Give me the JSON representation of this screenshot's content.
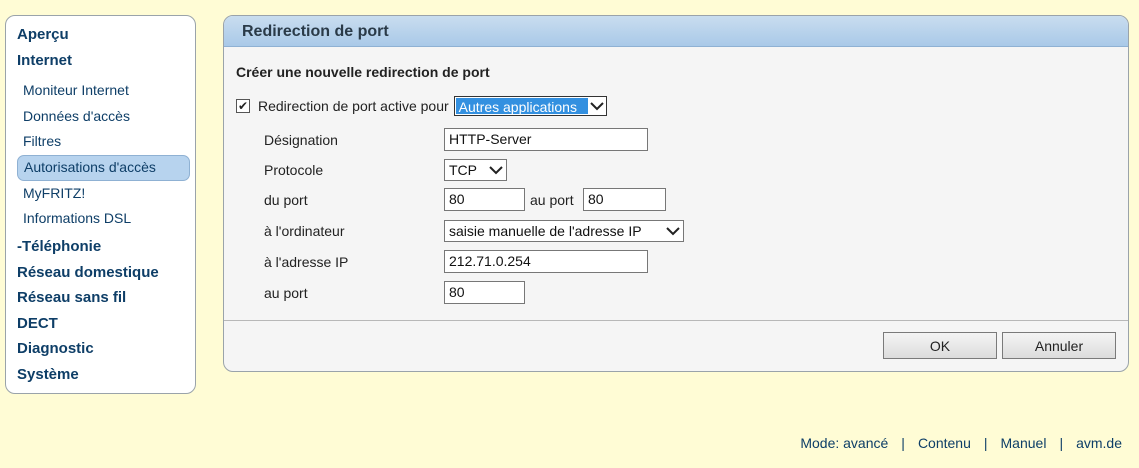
{
  "sidebar": {
    "items": [
      {
        "label": "Aperçu"
      },
      {
        "label": "Internet"
      },
      {
        "label": "Moniteur Internet"
      },
      {
        "label": "Données d'accès"
      },
      {
        "label": "Filtres"
      },
      {
        "label": "Autorisations d'accès"
      },
      {
        "label": "MyFRITZ!"
      },
      {
        "label": "Informations DSL"
      },
      {
        "label": "-Téléphonie"
      },
      {
        "label": "Réseau domestique"
      },
      {
        "label": "Réseau sans fil"
      },
      {
        "label": "DECT"
      },
      {
        "label": "Diagnostic"
      },
      {
        "label": "Système"
      }
    ]
  },
  "panel": {
    "title": "Redirection de port",
    "form_title": "Créer une nouvelle redirection de port",
    "active_checkbox": {
      "checked": true,
      "label": "Redirection de port active pour"
    },
    "application_select": {
      "value": "Autres applications"
    },
    "designation": {
      "label": "Désignation",
      "value": "HTTP-Server"
    },
    "protocol": {
      "label": "Protocole",
      "value": "TCP"
    },
    "from_port": {
      "label": "du port",
      "value": "80"
    },
    "to_port": {
      "label": "au port",
      "value": "80"
    },
    "computer": {
      "label": "à l'ordinateur",
      "value": "saisie manuelle de l'adresse IP"
    },
    "ip_address": {
      "label": "à l'adresse IP",
      "value": "212.71.0.254"
    },
    "dest_port": {
      "label": "au port",
      "value": "80"
    },
    "ok_label": "OK",
    "cancel_label": "Annuler"
  },
  "footer": {
    "mode": "Mode: avancé",
    "content": "Contenu",
    "manual": "Manuel",
    "site": "avm.de",
    "separator": "|"
  },
  "icons": {
    "checkbox": "check-icon",
    "dropdown": "chevron-down-icon"
  },
  "colors": {
    "page_background": "#fffcd5",
    "link": "#0e3e67",
    "header_blue": "#a9c9e8",
    "selection": "#3390e0",
    "active_nav": "#b7d3ee"
  }
}
